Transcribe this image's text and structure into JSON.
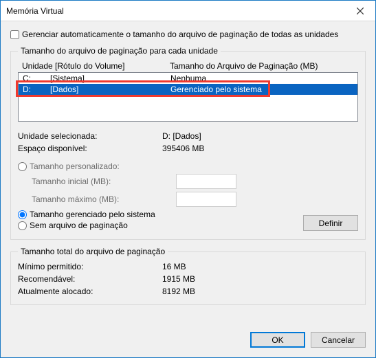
{
  "window": {
    "title": "Memória Virtual"
  },
  "auto_manage": {
    "label": "Gerenciar automaticamente o tamanho do arquivo de paginação de todas as unidades",
    "checked": false
  },
  "group_drives": {
    "legend": "Tamanho do arquivo de paginação para cada unidade",
    "header_drive": "Unidade [Rótulo do Volume]",
    "header_size": "Tamanho do Arquivo de Paginação (MB)",
    "rows": [
      {
        "drive": "C:",
        "label": "[Sistema]",
        "size": "Nenhuma",
        "selected": false
      },
      {
        "drive": "D:",
        "label": "[Dados]",
        "size": "Gerenciado pelo sistema",
        "selected": true
      }
    ],
    "selected_drive_label": "Unidade selecionada:",
    "selected_drive_value": "D:  [Dados]",
    "space_available_label": "Espaço disponível:",
    "space_available_value": "395406 MB",
    "radio_custom": "Tamanho personalizado:",
    "initial_label": "Tamanho inicial (MB):",
    "maximum_label": "Tamanho máximo (MB):",
    "initial_value": "",
    "maximum_value": "",
    "radio_system": "Tamanho gerenciado pelo sistema",
    "radio_none": "Sem arquivo de paginação",
    "set_button": "Definir"
  },
  "group_total": {
    "legend": "Tamanho total do arquivo de paginação",
    "min_label": "Mínimo permitido:",
    "min_value": "16 MB",
    "rec_label": "Recomendável:",
    "rec_value": "1915 MB",
    "cur_label": "Atualmente alocado:",
    "cur_value": "8192 MB"
  },
  "buttons": {
    "ok": "OK",
    "cancel": "Cancelar"
  }
}
